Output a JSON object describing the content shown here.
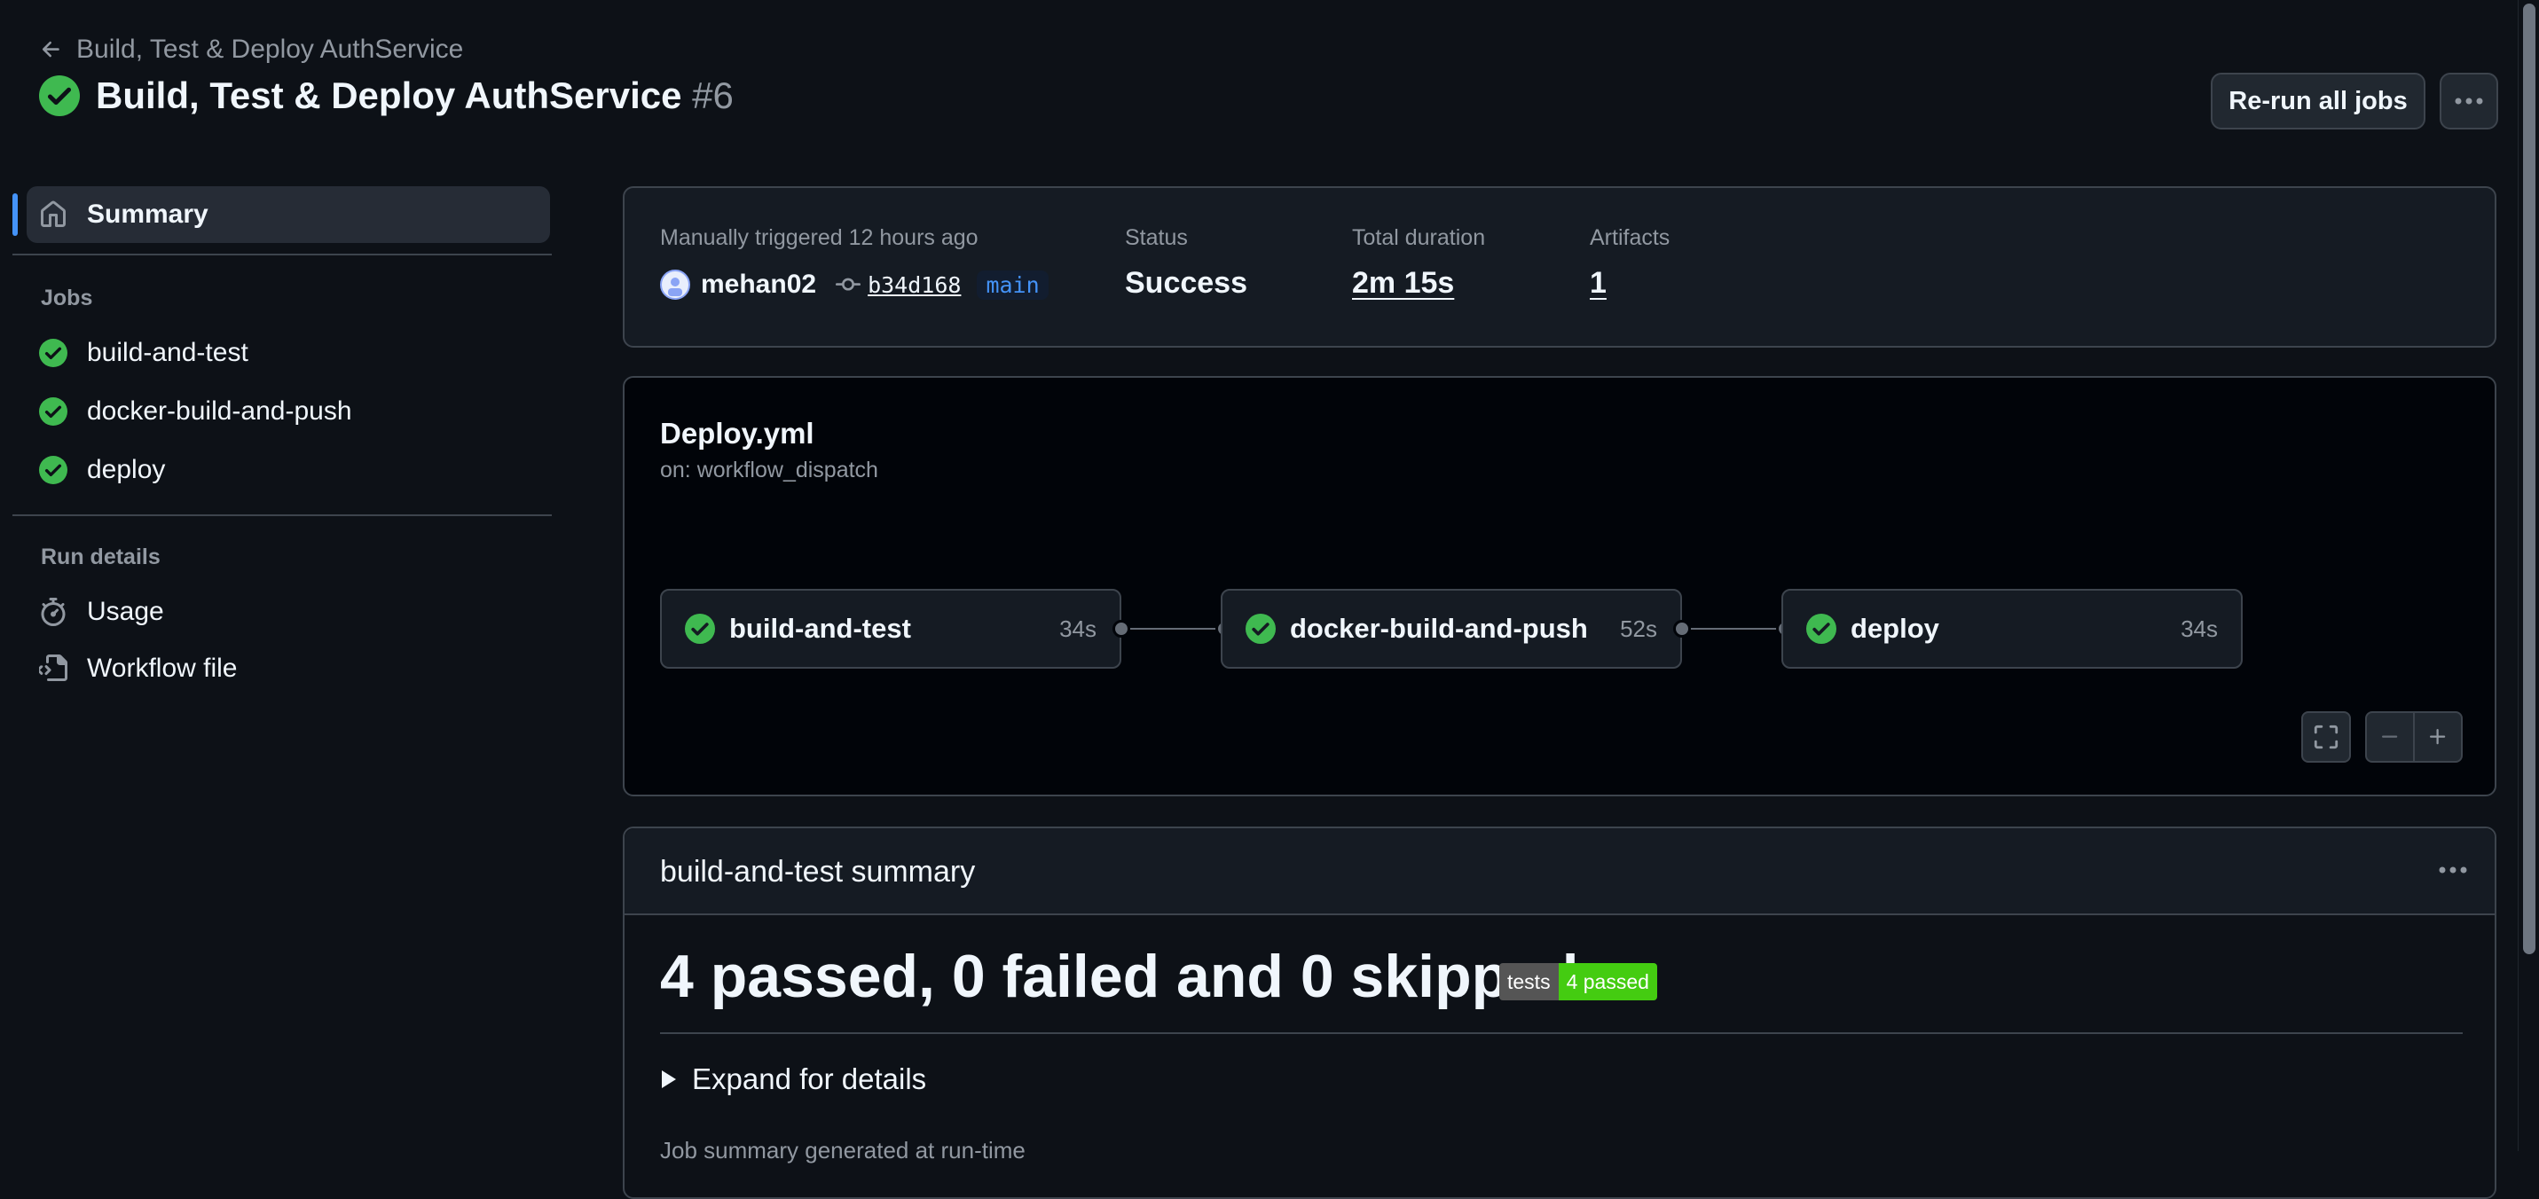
{
  "header": {
    "back_label": "Build, Test & Deploy AuthService",
    "title": "Build, Test & Deploy AuthService",
    "run_number": "#6",
    "rerun_label": "Re-run all jobs"
  },
  "sidebar": {
    "summary_label": "Summary",
    "jobs_heading": "Jobs",
    "jobs": [
      {
        "label": "build-and-test"
      },
      {
        "label": "docker-build-and-push"
      },
      {
        "label": "deploy"
      }
    ],
    "run_details_heading": "Run details",
    "usage_label": "Usage",
    "workflow_file_label": "Workflow file"
  },
  "meta": {
    "trigger_text": "Manually triggered 12 hours ago",
    "actor": "mehan02",
    "commit_sha": "b34d168",
    "branch": "main",
    "status_label": "Status",
    "status_value": "Success",
    "duration_label": "Total duration",
    "duration_value": "2m 15s",
    "artifacts_label": "Artifacts",
    "artifacts_value": "1"
  },
  "graph": {
    "workflow_name": "Deploy.yml",
    "trigger": "on: workflow_dispatch",
    "jobs": [
      {
        "name": "build-and-test",
        "duration": "34s"
      },
      {
        "name": "docker-build-and-push",
        "duration": "52s"
      },
      {
        "name": "deploy",
        "duration": "34s"
      }
    ]
  },
  "summary": {
    "title": "build-and-test summary",
    "heading": "4 passed, 0 failed and 0 skipped",
    "badge_left": "tests",
    "badge_right": "4 passed",
    "expand_label": "Expand for details",
    "partial_text": "Job summary generated at run-time"
  },
  "colors": {
    "success": "#3fb950",
    "accent": "#4493f8",
    "background": "#0d1117"
  }
}
